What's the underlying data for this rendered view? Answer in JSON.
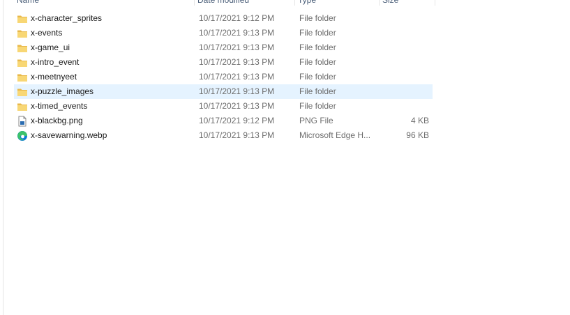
{
  "columns": {
    "name": "Name",
    "date": "Date modified",
    "type": "Type",
    "size": "Size"
  },
  "files": [
    {
      "name": "x-character_sprites",
      "date": "10/17/2021 9:12 PM",
      "type": "File folder",
      "size": "",
      "icon": "folder-icon",
      "selected": false
    },
    {
      "name": "x-events",
      "date": "10/17/2021 9:13 PM",
      "type": "File folder",
      "size": "",
      "icon": "folder-icon",
      "selected": false
    },
    {
      "name": "x-game_ui",
      "date": "10/17/2021 9:13 PM",
      "type": "File folder",
      "size": "",
      "icon": "folder-icon",
      "selected": false
    },
    {
      "name": "x-intro_event",
      "date": "10/17/2021 9:13 PM",
      "type": "File folder",
      "size": "",
      "icon": "folder-icon",
      "selected": false
    },
    {
      "name": "x-meetnyeet",
      "date": "10/17/2021 9:13 PM",
      "type": "File folder",
      "size": "",
      "icon": "folder-icon",
      "selected": false
    },
    {
      "name": "x-puzzle_images",
      "date": "10/17/2021 9:13 PM",
      "type": "File folder",
      "size": "",
      "icon": "folder-icon",
      "selected": true
    },
    {
      "name": "x-timed_events",
      "date": "10/17/2021 9:13 PM",
      "type": "File folder",
      "size": "",
      "icon": "folder-icon",
      "selected": false
    },
    {
      "name": "x-blackbg.png",
      "date": "10/17/2021 9:12 PM",
      "type": "PNG File",
      "size": "4 KB",
      "icon": "png-file-icon",
      "selected": false
    },
    {
      "name": "x-savewarning.webp",
      "date": "10/17/2021 9:13 PM",
      "type": "Microsoft Edge H...",
      "size": "96 KB",
      "icon": "edge-icon",
      "selected": false
    }
  ],
  "colors": {
    "selection": "#e5f3ff",
    "folder": "#f8d775",
    "secondary_text": "#6d6d6d"
  }
}
